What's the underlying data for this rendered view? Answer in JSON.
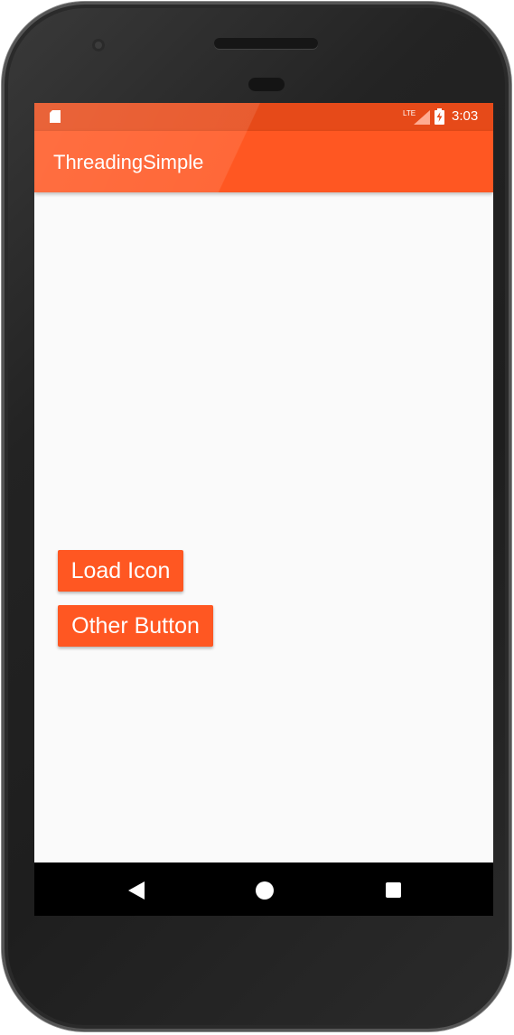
{
  "status_bar": {
    "time": "3:03",
    "network_label": "LTE",
    "icons": [
      "sd-card-icon",
      "lte-signal-icon",
      "battery-charging-icon"
    ]
  },
  "app_bar": {
    "title": "ThreadingSimple"
  },
  "content": {
    "buttons": [
      {
        "label": "Load Icon"
      },
      {
        "label": "Other Button"
      }
    ]
  },
  "nav_bar": {
    "icons": [
      "back-icon",
      "home-icon",
      "recents-icon"
    ]
  },
  "colors": {
    "primary": "#ff5722",
    "primary_dark": "#e64a19",
    "background": "#fafafa",
    "nav_bar": "#000000"
  }
}
